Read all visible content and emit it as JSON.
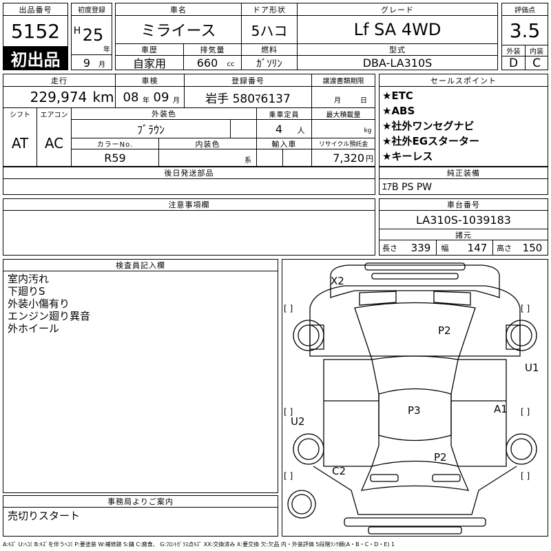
{
  "lot": {
    "header": "出品番号",
    "number": "5152",
    "badge": "初出品"
  },
  "first_reg": {
    "header": "初度登録",
    "era": "H",
    "year": "25",
    "year_unit": "年",
    "month": "9",
    "month_unit": "月"
  },
  "car_name": {
    "header": "車名",
    "value": "ミライース"
  },
  "history": {
    "header": "車歴",
    "value": "自家用"
  },
  "displacement": {
    "header": "排気量",
    "value": "660",
    "unit": "cc"
  },
  "door": {
    "header": "ドア形状",
    "value": "5ハコ"
  },
  "fuel": {
    "header": "燃料",
    "value": "ｶﾞｿﾘﾝ"
  },
  "grade": {
    "header": "グレード",
    "value": "Lf SA 4WD"
  },
  "model": {
    "header": "型式",
    "value": "DBA-LA310S"
  },
  "score": {
    "header": "評価点",
    "value": "3.5",
    "ext_header": "外装",
    "int_header": "内装",
    "ext": "D",
    "int": "C"
  },
  "mileage": {
    "header": "走行",
    "value": "229,974",
    "unit": "km"
  },
  "inspection": {
    "header": "車検",
    "year": "08",
    "year_unit": "年",
    "month": "09",
    "month_unit": "月"
  },
  "plate": {
    "header": "登録番号",
    "value": "岩手 580ﾏ6137"
  },
  "transfer": {
    "header": "譲渡書類期限",
    "month_unit": "月",
    "day_unit": "日"
  },
  "shift": {
    "header": "シフト",
    "value": "AT"
  },
  "aircon": {
    "header": "エアコン",
    "value": "AC"
  },
  "exterior_color": {
    "header": "外装色",
    "value": "ﾌﾞﾗｳﾝ"
  },
  "capacity": {
    "header": "乗車定員",
    "value": "4",
    "unit": "人"
  },
  "max_load": {
    "header": "最大積載量",
    "unit": "kg"
  },
  "color_no": {
    "header": "カラーNo.",
    "value": "R59"
  },
  "interior_color": {
    "header": "内装色",
    "unit": "系"
  },
  "import": {
    "header": "輸入車"
  },
  "recycle": {
    "header": "リサイクル預託金",
    "value": "7,320",
    "unit": "円"
  },
  "sales_points": {
    "header": "セールスポイント",
    "items": [
      "★ETC",
      "★ABS",
      "★社外ワンセグナビ",
      "★社外EGスターター",
      "★キーレス"
    ]
  },
  "later_parts": {
    "header": "後日発送部品"
  },
  "equipment": {
    "header": "純正装備",
    "value": "ｴｱB PS PW"
  },
  "notes": {
    "header": "注意事項欄"
  },
  "chassis": {
    "header": "車台番号",
    "value": "LA310S-1039183"
  },
  "dimensions": {
    "header": "諸元",
    "length_label": "長さ",
    "length": "339",
    "width_label": "幅",
    "width": "147",
    "height_label": "高さ",
    "height": "150"
  },
  "inspector": {
    "header": "検査員記入欄",
    "lines": [
      "室内汚れ",
      "下廻りS",
      "外装小傷有り",
      "エンジン廻り異音",
      "外ホイール"
    ]
  },
  "office": {
    "header": "事務局よりご案内",
    "value": "売切りスタート"
  },
  "diagram": {
    "marks": [
      "X2",
      "P2",
      "U1",
      "P3",
      "A1",
      "U2",
      "P2",
      "C2"
    ],
    "bracket": "[ ]"
  },
  "legend": "A:ｷｽﾞ U:ﾍｺﾐ B:ｷｽﾞを伴うﾍｺﾐ P:要塗装 W:補修跡 S:錆 C:腐食、 G:ﾌﾛﾝﾄｶﾞﾗｽ点ｷｽﾞ XX:交換済み X:要交換 欠:欠品 内・外装評価 5段階ﾗﾝｸ順(A・B・C・D・E) 1"
}
